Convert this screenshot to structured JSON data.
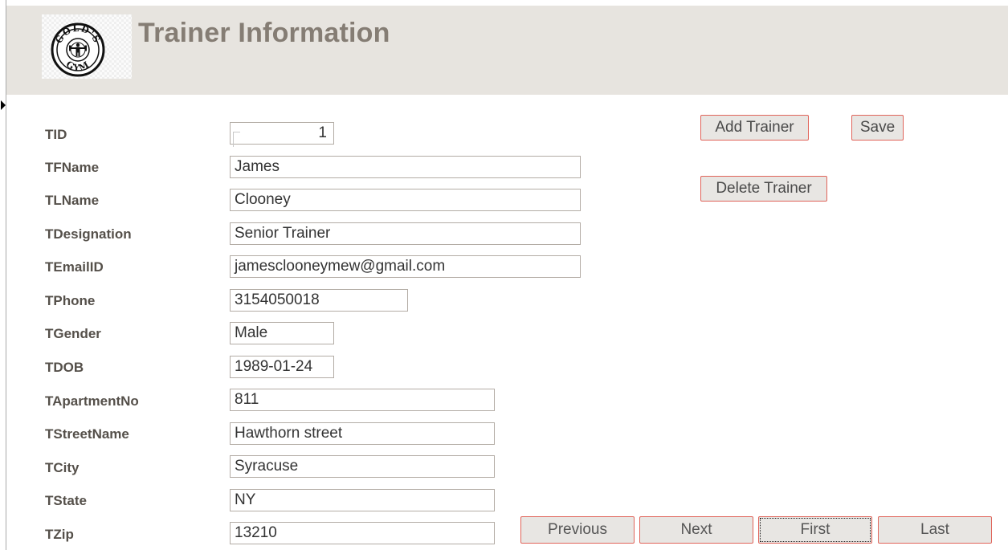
{
  "header": {
    "title": "Trainer Information",
    "logo_text": "GOLD'S GYM"
  },
  "fields": [
    {
      "label": "TID",
      "value": "1"
    },
    {
      "label": "TFName",
      "value": "James"
    },
    {
      "label": "TLName",
      "value": "Clooney"
    },
    {
      "label": "TDesignation",
      "value": "Senior Trainer"
    },
    {
      "label": "TEmailID",
      "value": "jamesclooneymew@gmail.com"
    },
    {
      "label": "TPhone",
      "value": "3154050018"
    },
    {
      "label": "TGender",
      "value": "Male"
    },
    {
      "label": "TDOB",
      "value": "1989-01-24"
    },
    {
      "label": "TApartmentNo",
      "value": "811"
    },
    {
      "label": "TStreetName",
      "value": "Hawthorn street"
    },
    {
      "label": "TCity",
      "value": "Syracuse"
    },
    {
      "label": "TState",
      "value": "NY"
    },
    {
      "label": "TZip",
      "value": "13210"
    }
  ],
  "actions": {
    "add_trainer": "Add Trainer",
    "save": "Save",
    "delete_trainer": "Delete Trainer"
  },
  "navigation": {
    "previous": "Previous",
    "next": "Next",
    "first": "First",
    "last": "Last"
  },
  "colors": {
    "header_bg": "#e7e4df",
    "title": "#857d74",
    "label": "#55504a",
    "button_border": "#e0645a"
  }
}
